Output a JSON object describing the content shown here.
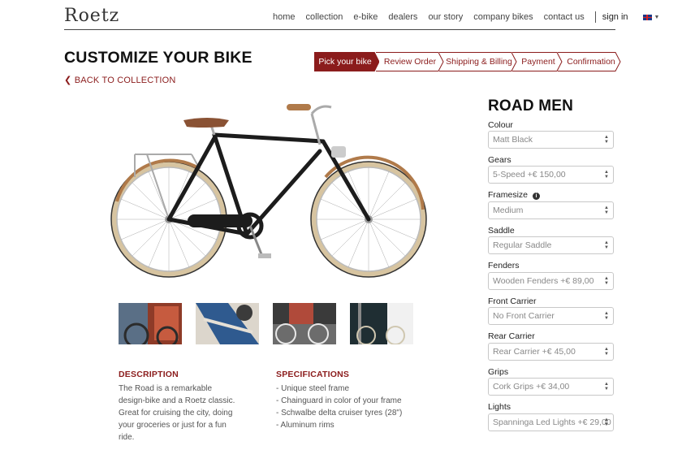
{
  "header": {
    "logo_text": "Roetz",
    "nav": [
      "home",
      "collection",
      "e-bike",
      "dealers",
      "our story",
      "company bikes",
      "contact us"
    ],
    "signin": "sign in",
    "language_icon": "uk-flag-icon"
  },
  "page": {
    "title": "CUSTOMIZE YOUR BIKE",
    "back_label": "BACK TO COLLECTION"
  },
  "steps": [
    {
      "label": "Pick your bike",
      "active": true
    },
    {
      "label": "Review Order",
      "active": false
    },
    {
      "label": "Shipping & Billing",
      "active": false
    },
    {
      "label": "Payment",
      "active": false
    },
    {
      "label": "Confirmation",
      "active": false
    }
  ],
  "product": {
    "name": "ROAD MEN",
    "options": [
      {
        "label": "Colour",
        "value": "Matt Black"
      },
      {
        "label": "Gears",
        "value": "5-Speed +€ 150,00"
      },
      {
        "label": "Framesize",
        "value": "Medium",
        "info": true
      },
      {
        "label": "Saddle",
        "value": "Regular Saddle"
      },
      {
        "label": "Fenders",
        "value": "Wooden Fenders +€ 89,00"
      },
      {
        "label": "Front Carrier",
        "value": "No Front Carrier"
      },
      {
        "label": "Rear Carrier",
        "value": "Rear Carrier +€ 45,00"
      },
      {
        "label": "Grips",
        "value": "Cork Grips +€ 34,00"
      },
      {
        "label": "Lights",
        "value": "Spanninga Led Lights +€ 29,00"
      }
    ]
  },
  "description": {
    "heading": "DESCRIPTION",
    "text": "The Road is a remarkable design-bike and a Roetz classic. Great for cruising the city, doing your groceries or just for a fun ride."
  },
  "specifications": {
    "heading": "SPECIFICATIONS",
    "items": [
      "- Unique steel frame",
      "- Chainguard in color of your frame",
      "- Schwalbe delta cruiser tyres (28\")",
      "- Aluminum rims"
    ]
  },
  "colors": {
    "accent": "#8b1c1c",
    "frame": "#1c1c1c",
    "saddle": "#8a5234",
    "tyre_wall": "#d7c4a0"
  }
}
